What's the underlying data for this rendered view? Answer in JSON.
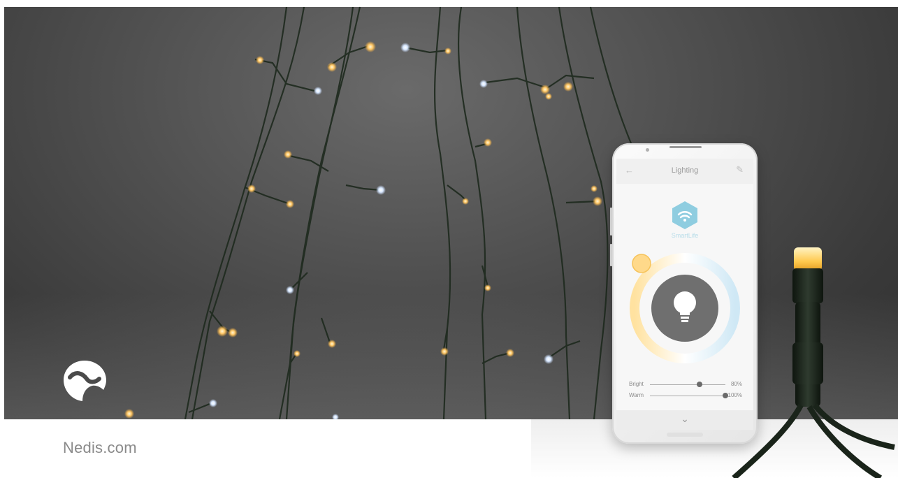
{
  "footer": {
    "site": "Nedis.com"
  },
  "app": {
    "title": "Lighting",
    "brand": "SmartLife",
    "sliders": [
      {
        "label": "Bright",
        "value": "80%",
        "level": 0.62
      },
      {
        "label": "Warm",
        "value": "100%",
        "level": 1.0
      }
    ],
    "icons": {
      "back": "back-arrow-icon",
      "edit": "pencil-icon",
      "bulb": "lightbulb-icon",
      "collapse": "chevron-down-icon"
    }
  },
  "colors": {
    "warm_led": "#ffc766",
    "cool_led": "#e8f2ff",
    "accent": "#7cc0d6",
    "wire": "#1e2a1e"
  }
}
